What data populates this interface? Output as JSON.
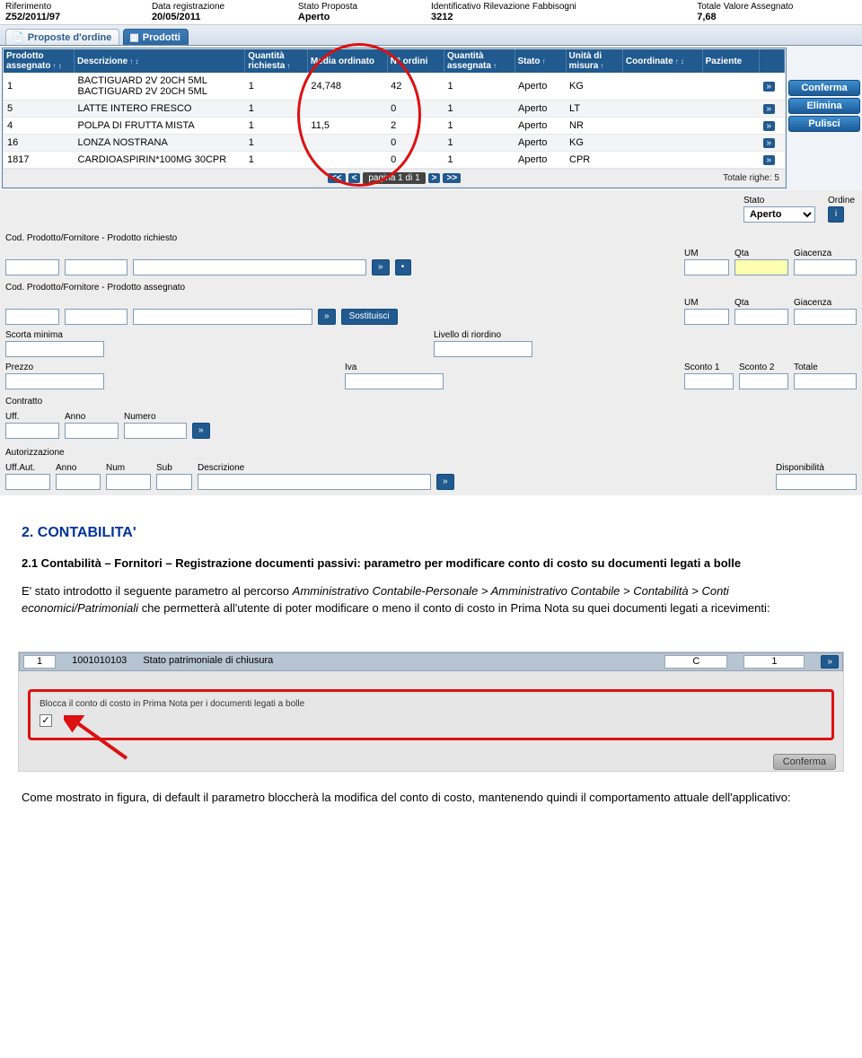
{
  "header": {
    "fields": [
      {
        "label": "Riferimento",
        "value": "Z52/2011/97"
      },
      {
        "label": "Data registrazione",
        "value": "20/05/2011"
      },
      {
        "label": "Stato Proposta",
        "value": "Aperto"
      },
      {
        "label": "Identificativo Rilevazione Fabbisogni",
        "value": "3212"
      },
      {
        "label": "Totale Valore Assegnato",
        "value": "7,68"
      }
    ]
  },
  "tabs": [
    {
      "label": "Proposte d'ordine",
      "active": false
    },
    {
      "label": "Prodotti",
      "active": true
    }
  ],
  "grid": {
    "columns": [
      "Prodotto assegnato",
      "Descrizione",
      "Quantità richiesta",
      "Media ordinato",
      "N° ordini",
      "Quantità assegnata",
      "Stato",
      "Unità di misura",
      "Coordinate",
      "Paziente",
      ""
    ],
    "rows": [
      {
        "prodotto": "1",
        "descrizione": "BACTIGUARD 2V 20CH 5ML BACTIGUARD 2V 20CH 5ML",
        "qr": "1",
        "media": "24,748",
        "nord": "42",
        "qa": "1",
        "stato": "Aperto",
        "um": "KG",
        "coord": "",
        "paz": ""
      },
      {
        "prodotto": "5",
        "descrizione": "LATTE INTERO FRESCO",
        "qr": "1",
        "media": "",
        "nord": "0",
        "qa": "1",
        "stato": "Aperto",
        "um": "LT",
        "coord": "",
        "paz": ""
      },
      {
        "prodotto": "4",
        "descrizione": "POLPA DI FRUTTA MISTA",
        "qr": "1",
        "media": "11,5",
        "nord": "2",
        "qa": "1",
        "stato": "Aperto",
        "um": "NR",
        "coord": "",
        "paz": ""
      },
      {
        "prodotto": "16",
        "descrizione": "LONZA NOSTRANA",
        "qr": "1",
        "media": "",
        "nord": "0",
        "qa": "1",
        "stato": "Aperto",
        "um": "KG",
        "coord": "",
        "paz": ""
      },
      {
        "prodotto": "1817",
        "descrizione": "CARDIOASPIRIN*100MG 30CPR",
        "qr": "1",
        "media": "",
        "nord": "0",
        "qa": "1",
        "stato": "Aperto",
        "um": "CPR",
        "coord": "",
        "paz": ""
      }
    ],
    "pager": {
      "text": "pagina 1 di 1",
      "total": "Totale righe: 5"
    }
  },
  "sideButtons": [
    "Conferma",
    "Elimina",
    "Pulisci"
  ],
  "statoOrdine": {
    "statoLabel": "Stato",
    "statoValue": "Aperto",
    "ordineLabel": "Ordine"
  },
  "form": {
    "sec1": "Cod. Prodotto/Fornitore - Prodotto richiesto",
    "sec2": "Cod. Prodotto/Fornitore - Prodotto assegnato",
    "sostituisci": "Sostituisci",
    "um": "UM",
    "qta": "Qta",
    "giacenza": "Giacenza",
    "scorta": "Scorta minima",
    "livello": "Livello di riordino",
    "prezzo": "Prezzo",
    "iva": "Iva",
    "sconto1": "Sconto 1",
    "sconto2": "Sconto 2",
    "totale": "Totale",
    "contratto": {
      "main": "Contratto",
      "uff": "Uff.",
      "anno": "Anno",
      "numero": "Numero"
    },
    "aut": {
      "main": "Autorizzazione",
      "uffaut": "Uff.Aut.",
      "anno": "Anno",
      "num": "Num",
      "sub": "Sub",
      "descr": "Descrizione",
      "disp": "Disponibilità"
    }
  },
  "doc": {
    "h2": "2. CONTABILITA'",
    "h3": "2.1 Contabilità – Fornitori – Registrazione documenti passivi: parametro per modificare conto di costo su documenti legati a bolle",
    "p1a": "E' stato introdotto il seguente parametro al percorso ",
    "p1b": "Amministrativo Contabile-Personale > Amministrativo Contabile > Contabilità > Conti economici/Patrimoniali",
    "p1c": " che permetterà all'utente di poter modificare o meno il conto di costo in Prima Nota su quei documenti legati a ricevimenti:",
    "sub": {
      "row": [
        "1",
        "1001010103",
        "Stato patrimoniale di chiusura",
        "C",
        "1"
      ],
      "chkLabel": "Blocca il conto di costo in Prima Nota per i documenti legati a bolle",
      "confirm": "Conferma"
    },
    "p2": "Come mostrato in figura, di default il parametro bloccherà la modifica del conto di costo, mantenendo quindi il comportamento attuale dell'applicativo:"
  }
}
